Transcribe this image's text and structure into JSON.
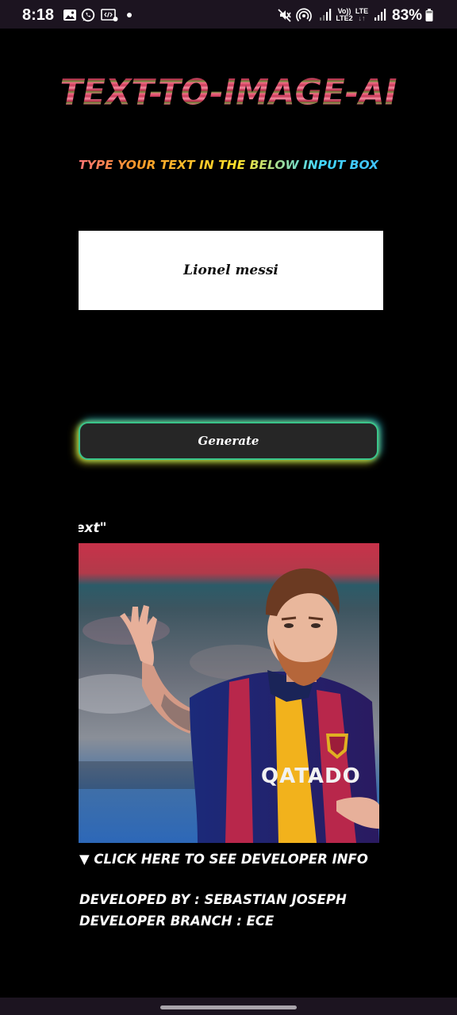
{
  "status_bar": {
    "time": "8:18",
    "net_top": "Vo))",
    "net_bottom": "LTE2",
    "lte_label": "LTE",
    "lte_arrows": "↓↑",
    "battery": "83%",
    "icons": [
      "gallery-icon",
      "whatsapp-icon",
      "screen-recorder-icon",
      "notification-dot-icon",
      "mute-icon",
      "hotspot-icon",
      "signal-icon",
      "battery-icon"
    ]
  },
  "title": "TEXT-TO-IMAGE-AI",
  "subtitle": "TYPE YOUR TEXT IN THE BELOW INPUT BOX",
  "input": {
    "value": "Lionel messi"
  },
  "generate_label": "Generate",
  "caption": "ext\"",
  "developer": {
    "toggle_label": "▼ CLICK HERE TO SEE DEVELOPER INFO",
    "developed_by": "DEVELOPED BY : SEBASTIAN JOSEPH",
    "branch": "DEVELOPER BRANCH : ECE"
  },
  "colors": {
    "background": "#000000",
    "title_pink": "#e24e6e",
    "button_bg": "#262626",
    "button_glow_green": "#3ac48a",
    "button_glow_yellow": "#d6d228"
  }
}
